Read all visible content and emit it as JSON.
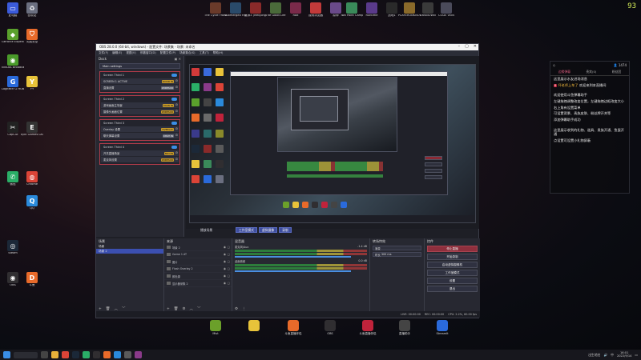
{
  "corner_number": "93",
  "desktop_left_icons": [
    {
      "label": "此电脑",
      "color": "#3b5bdb",
      "glyph": "▭"
    },
    {
      "label": "回收站",
      "color": "#6b6f80",
      "glyph": "♻"
    },
    {
      "label": "GeForce Experience",
      "color": "#5aa02c",
      "glyph": "◆"
    },
    {
      "label": "火绒安全",
      "color": "#e86a2a",
      "glyph": "⛉"
    },
    {
      "label": "NVIDIA Broadcast",
      "color": "#4a9a2a",
      "glyph": "◉"
    },
    {
      "label": "Logitech G HUB",
      "color": "#2a6adb",
      "glyph": "G"
    },
    {
      "label": "YY",
      "color": "#e8c33a",
      "glyph": "Y"
    },
    {
      "label": "Epic Games Launcher",
      "color": "#333333",
      "glyph": "E"
    },
    {
      "label": "CapCut",
      "color": "#222222",
      "glyph": "✂"
    },
    {
      "label": "微信",
      "color": "#2aae67",
      "glyph": "✆"
    },
    {
      "label": "Chrome",
      "color": "#db4437",
      "glyph": "◍"
    },
    {
      "label": "QQ",
      "color": "#2a8adb",
      "glyph": "Q"
    },
    {
      "label": "Steam",
      "color": "#1b2838",
      "glyph": "◎"
    },
    {
      "label": "OBS",
      "color": "#302e31",
      "glyph": "◉"
    },
    {
      "label": "斗鱼",
      "color": "#e86a2a",
      "glyph": "D"
    }
  ],
  "desktop_top_icons": [
    {
      "label": "The Cycle Frontier",
      "color": "#6a3a2a"
    },
    {
      "label": "Submerged Hidden D...",
      "color": "#2a4a6a"
    },
    {
      "label": "巫师3 (Melijong...",
      "color": "#8a2a2a"
    },
    {
      "label": "The Good Life",
      "color": "#4a6a3a"
    },
    {
      "label": "Rolt",
      "color": "#7a2a4a"
    },
    {
      "label": "搜狗浏览器",
      "color": "#c23a3a"
    },
    {
      "label": "原神",
      "color": "#6a4a8a"
    },
    {
      "label": "Two Point Campus",
      "color": "#3a8a5a"
    },
    {
      "label": "Runtime",
      "color": "#5a3a8a"
    },
    {
      "label": "战地1",
      "color": "#2a2a2a"
    },
    {
      "label": "PLAYERUNKNOWN BATTLEGR...",
      "color": "#8a6a2a"
    },
    {
      "label": "UNKNOWN",
      "color": "#3a3a3a"
    },
    {
      "label": "CODE VEIN",
      "color": "#4a4a5a"
    }
  ],
  "obs": {
    "title": "OBS 28.0.0 (64-bit, windows) - 配置文件: 场景集 - 场景: 未命名",
    "menu": [
      "文件(F)",
      "编辑(E)",
      "视图(V)",
      "停靠窗口(D)",
      "配置文件(P)",
      "场景集合(S)",
      "工具(T)",
      "帮助(H)"
    ],
    "dock": {
      "title": "Dock",
      "main_settings": "Main settings",
      "panels": [
        {
          "title": "Screen Third 1",
          "rows": [
            {
              "text": "SCREEN 1 ACTIVE",
              "tag": "DOOR IN"
            },
            {
              "text": "直播设置",
              "tag": "WIDESCR"
            }
          ]
        },
        {
          "title": "Screen Third 2",
          "rows": [
            {
              "text": "游戏画面主场景",
              "tag": "MAIN IN"
            },
            {
              "text": "摄像头画面位置",
              "tag": "WIDESCR"
            }
          ]
        },
        {
          "title": "Screen Third 3",
          "rows": [
            {
              "text": "Overlay 设置",
              "tag": "OVERLAY"
            },
            {
              "text": "聊天弹幕设置",
              "tag": "CHAT IN"
            }
          ]
        },
        {
          "title": "Screen Third 4",
          "rows": [
            {
              "text": "开关直播场景",
              "tag": "MICON"
            },
            {
              "text": "麦克风设置",
              "tag": "WIDESCR"
            }
          ]
        }
      ]
    },
    "scene_label": "播放场景",
    "buttons": {
      "studio": "工作室模式",
      "virtualcam": "虚拟摄像",
      "record": "录制"
    },
    "panels": {
      "scenes": {
        "title": "场景",
        "items": [
          "场景",
          "场景 2"
        ]
      },
      "sources": {
        "title": "来源",
        "items": [
          "场景 2",
          "Game 1 AT",
          "图片",
          "Flash Overlay 2",
          "颜色源",
          "显示器采集 2"
        ]
      },
      "mixer": {
        "title": "混音器",
        "tracks": [
          {
            "name": "麦克风/Aux",
            "level": "-1.4 dB"
          },
          {
            "name": "桌面音频",
            "level": "0.0 dB"
          }
        ]
      },
      "transitions": {
        "title": "转场特效",
        "type": "渐变",
        "duration_label": "时长",
        "duration": "300 ms"
      },
      "controls": {
        "title": "控件",
        "buttons": [
          "停止直播",
          "开始录制",
          "启动虚拟摄像机",
          "工作室模式",
          "设置",
          "退出"
        ]
      }
    },
    "status": {
      "live": "LIVE: 00:00:00",
      "rec": "REC: 00:00:00",
      "cpu": "CPU: 2.2%, 60.00 fps"
    }
  },
  "chat": {
    "top_left": "◇",
    "count": "1474",
    "tabs": [
      "边缘弹幕",
      "贵宾(0)",
      "粉丝团"
    ],
    "lines": [
      {
        "text": "这里展示水友进场消息"
      },
      {
        "badge": "8",
        "gold": "坏老师上车了",
        "text": " 欢迎来到本直播间"
      },
      {
        "text": "欢迎使用斗鱼弹幕助手"
      },
      {
        "text": "左键拖拽调整改变位置，左键拖拽边框改变大小"
      },
      {
        "text": "右上角有设置菜单"
      },
      {
        "text": "可设置背景、贵族皮肤、粉丝牌开关等"
      },
      {
        "text": "添加弹幕助手成功"
      },
      {
        "text": "这里展示收到的礼物、道具、贵族开通、鱼蛋开通"
      },
      {
        "text": "点设置可设置小礼物屏蔽"
      }
    ]
  },
  "bottom_icons": [
    {
      "label": "Mist",
      "color": "#6ba02a"
    },
    {
      "label": "",
      "color": "#e8c33a"
    },
    {
      "label": "斗鱼直播伴侣",
      "color": "#e86a2a"
    },
    {
      "label": "OBS",
      "color": "#302e31"
    },
    {
      "label": "斗鱼直播伴侣",
      "color": "#c0233b"
    },
    {
      "label": "直播助手",
      "color": "#444"
    },
    {
      "label": "StreamIt",
      "color": "#2a6adb"
    }
  ],
  "taskbar": {
    "clock_time": "16:01",
    "clock_date": "2022/9/14",
    "tray_lang": "中",
    "tray_text": "出生地名"
  }
}
